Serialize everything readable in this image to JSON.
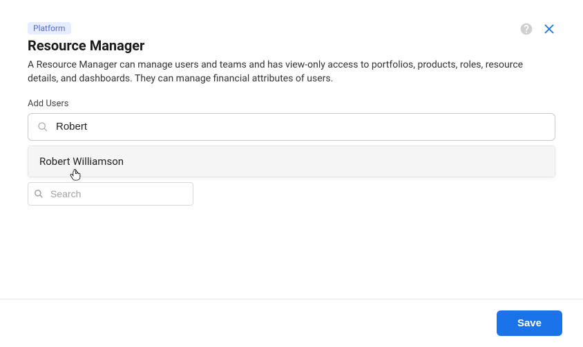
{
  "header": {
    "badge": "Platform",
    "title": "Resource Manager",
    "description": "A Resource Manager can manage users and teams and has view-only access to portfolios, products, roles, resource details, and dashboards. They can manage financial attributes of users."
  },
  "add_users": {
    "label": "Add Users",
    "search_value": "Robert",
    "dropdown": {
      "options": [
        {
          "name": "Robert Williamson"
        }
      ]
    }
  },
  "secondary_search": {
    "placeholder": "Search"
  },
  "footer": {
    "save_label": "Save"
  }
}
